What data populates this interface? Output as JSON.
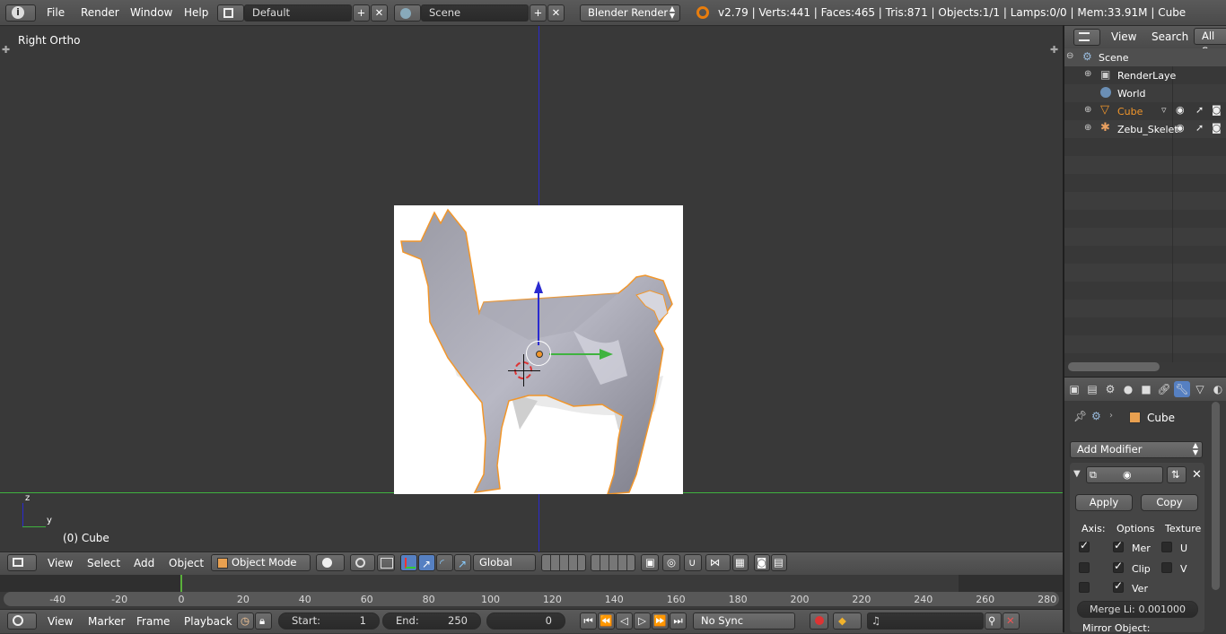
{
  "top_bar": {
    "menus": [
      "File",
      "Render",
      "Window",
      "Help"
    ],
    "layout_name": "Default",
    "scene_name": "Scene",
    "render_engine": "Blender Render",
    "stats": "v2.79 | Verts:441 | Faces:465 | Tris:871 | Objects:1/1 | Lamps:0/0 | Mem:33.91M | Cube"
  },
  "viewport": {
    "view_label": "Right Ortho",
    "object_label": "(0) Cube",
    "axis_z": "z",
    "axis_y": "y"
  },
  "viewport_header": {
    "menus": [
      "View",
      "Select",
      "Add",
      "Object"
    ],
    "mode": "Object Mode",
    "orientation": "Global"
  },
  "timeline": {
    "ticks": [
      "-40",
      "-20",
      "0",
      "20",
      "40",
      "60",
      "80",
      "100",
      "120",
      "140",
      "160",
      "180",
      "200",
      "220",
      "240",
      "260",
      "280"
    ],
    "menus": [
      "View",
      "Marker",
      "Frame",
      "Playback"
    ],
    "start_label": "Start:",
    "start_value": "1",
    "end_label": "End:",
    "end_value": "250",
    "current_frame": "0",
    "sync": "No Sync"
  },
  "outliner": {
    "menus": [
      "View",
      "Search"
    ],
    "filter": "All Sc",
    "items": [
      {
        "label": "Scene"
      },
      {
        "label": "RenderLaye"
      },
      {
        "label": "World"
      },
      {
        "label": "Cube"
      },
      {
        "label": "Zebu_Skelet"
      }
    ]
  },
  "properties": {
    "breadcrumb_object": "Cube",
    "add_modifier": "Add Modifier",
    "apply": "Apply",
    "copy": "Copy",
    "axis_label": "Axis:",
    "options_label": "Options",
    "texture_label": "Texture",
    "opt_merge": "Mer",
    "opt_clip": "Clip",
    "opt_vert": "Ver",
    "tex_u": "U",
    "tex_v": "V",
    "merge_limit_label": "Merge Li:",
    "merge_limit_value": "0.001000",
    "mirror_object_label": "Mirror Object:"
  },
  "colors": {
    "accent_blue": "#5680c2",
    "selection_orange": "#f1962b",
    "axis_green": "#3fb33f",
    "axis_blue": "#2a2ad0"
  }
}
